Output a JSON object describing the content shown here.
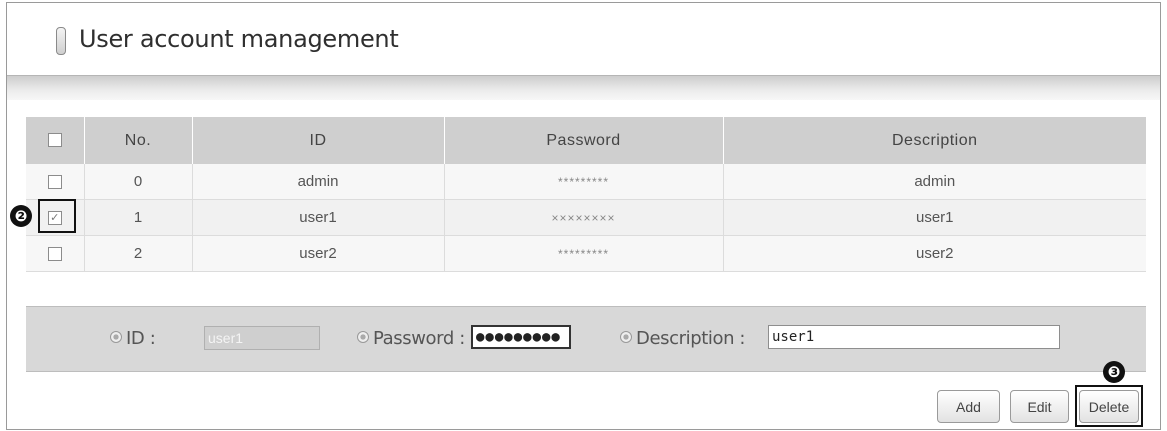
{
  "header": {
    "title": "User account management"
  },
  "table": {
    "columns": [
      "No.",
      "ID",
      "Password",
      "Description"
    ],
    "rows": [
      {
        "no": "0",
        "id": "admin",
        "password": "*********",
        "description": "admin",
        "checked": false
      },
      {
        "no": "1",
        "id": "user1",
        "password": "××××××××",
        "description": "user1",
        "checked": true
      },
      {
        "no": "2",
        "id": "user2",
        "password": "*********",
        "description": "user2",
        "checked": false
      }
    ]
  },
  "form": {
    "id_label": "ID :",
    "id_value": "user1",
    "password_label": "Password :",
    "password_value": "●●●●●●●●●",
    "description_label": "Description :",
    "description_value": "user1"
  },
  "buttons": {
    "add": "Add",
    "edit": "Edit",
    "delete": "Delete"
  },
  "annotations": {
    "step_2": "❷",
    "step_3": "❸"
  },
  "colors": {
    "header_bg": "#cfcfcf",
    "panel_bg": "#d8d8d8",
    "highlight": "#111111"
  }
}
